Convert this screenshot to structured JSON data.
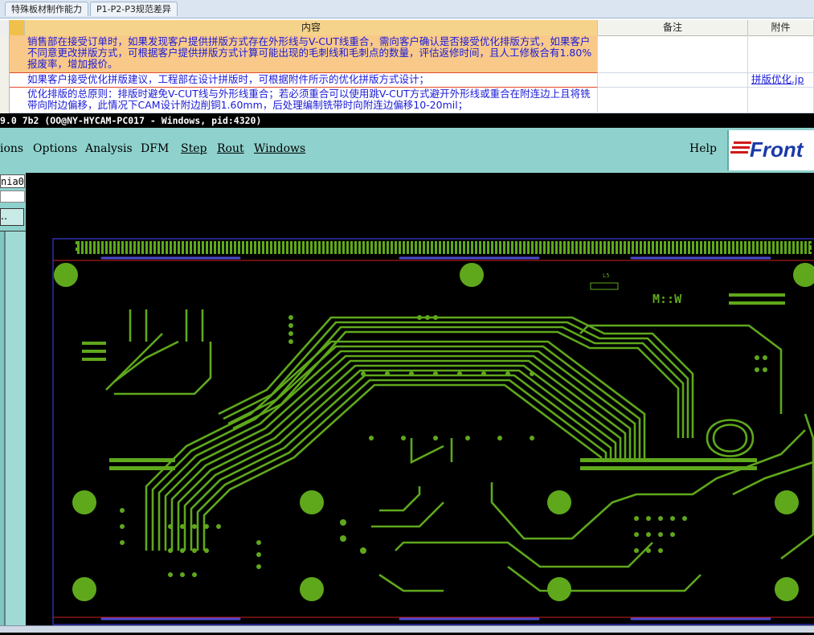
{
  "sheet": {
    "tabs": [
      "特殊板材制作能力",
      "P1-P2-P3规范差异"
    ],
    "columns": [
      "内容",
      "备注",
      "附件"
    ],
    "rows": [
      {
        "content": "销售部在接受订单时，如果发现客户提供拼版方式存在外形线与V-CUT线重合，需向客户确认是否接受优化排版方式，如果客户不同意更改拼版方式，可根据客户提供拼版方式计算可能出现的毛刺线和毛刺点的数量，评估返修时间，且人工修板合有1.80%报废率，增加报价。",
        "remark": "",
        "attachment": ""
      },
      {
        "content": "如果客户接受优化拼版建议，工程部在设计拼版时，可根据附件所示的优化拼版方式设计；",
        "remark": "",
        "attachment": "拼版优化.jp"
      },
      {
        "content": "优化排版的总原则：排版时避免V-CUT线与外形线重合；若必须重合可以使用跳V-CUT方式避开外形线或重合在附连边上且将铣带向附边偏移，此情况下CAM设计附边削铜1.60mm，后处理编制铣带时向附连边偏移10-20mil；",
        "remark": "",
        "attachment": ""
      }
    ]
  },
  "cam": {
    "title": "9.0 7b2 (OO@NY-HYCAM-PC017 - Windows, pid:4320)",
    "menu": [
      "ions",
      "Options",
      "Analysis",
      "DFM",
      "Step",
      "Rout",
      "Windows"
    ],
    "help": "Help",
    "logo": "Front",
    "left_field": "nia0",
    "left_button": "..",
    "board_label": "L5",
    "silk_text": "M::W"
  },
  "colors": {
    "trace": "#5fa81c",
    "menubar": "#8fd2cd",
    "sheet_highlight": "#f9c98a",
    "link": "#1a1ad8"
  }
}
